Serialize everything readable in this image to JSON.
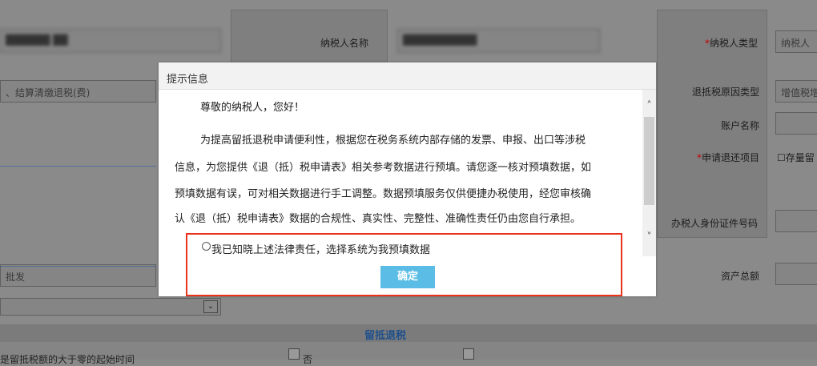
{
  "form": {
    "taxpayer_id_value": "",
    "taxpayer_name_label": "纳税人名称",
    "taxpayer_name_value": "",
    "taxpayer_type_label": "纳税人类型",
    "taxpayer_type_value": "纳税人",
    "refund_reason_value": "、结算清缴退税(费)",
    "refund_type_label": "退抵税原因类型",
    "refund_type_value": "增值税增",
    "account_name_label": "账户名称",
    "refund_item_label": "申请退还项目",
    "refund_item_checkbox": "存量留",
    "agent_id_label": "办税人身份证件号码",
    "industry_value": "批发",
    "total_assets_label": "资产总额",
    "section_title": "留抵退税",
    "bottom_text": "是留抵税额的大于零的起始时间",
    "bottom_right_text": "否"
  },
  "dialog": {
    "title": "提示信息",
    "greeting": "尊敬的纳税人，您好！",
    "para_line1": "为提高留抵退税申请便利性，根据您在税务系统内部存储的发票、申报、出口等涉税",
    "para_line2": "信息，为您提供《退（抵）税申请表》相关参考数据进行预填。请您逐一核对预填数据，如",
    "para_line3": "预填数据有误，可对相关数据进行手工调整。数据预填服务仅供便捷办税使用，经您审核确",
    "para_line4": "认《退（抵）税申请表》数据的合规性、真实性、完整性、准确性责任仍由您自行承担。",
    "radio_label": "我已知晓上述法律责任，选择系统为我预填数据",
    "ok_label": "确定",
    "required_mark": "*"
  }
}
